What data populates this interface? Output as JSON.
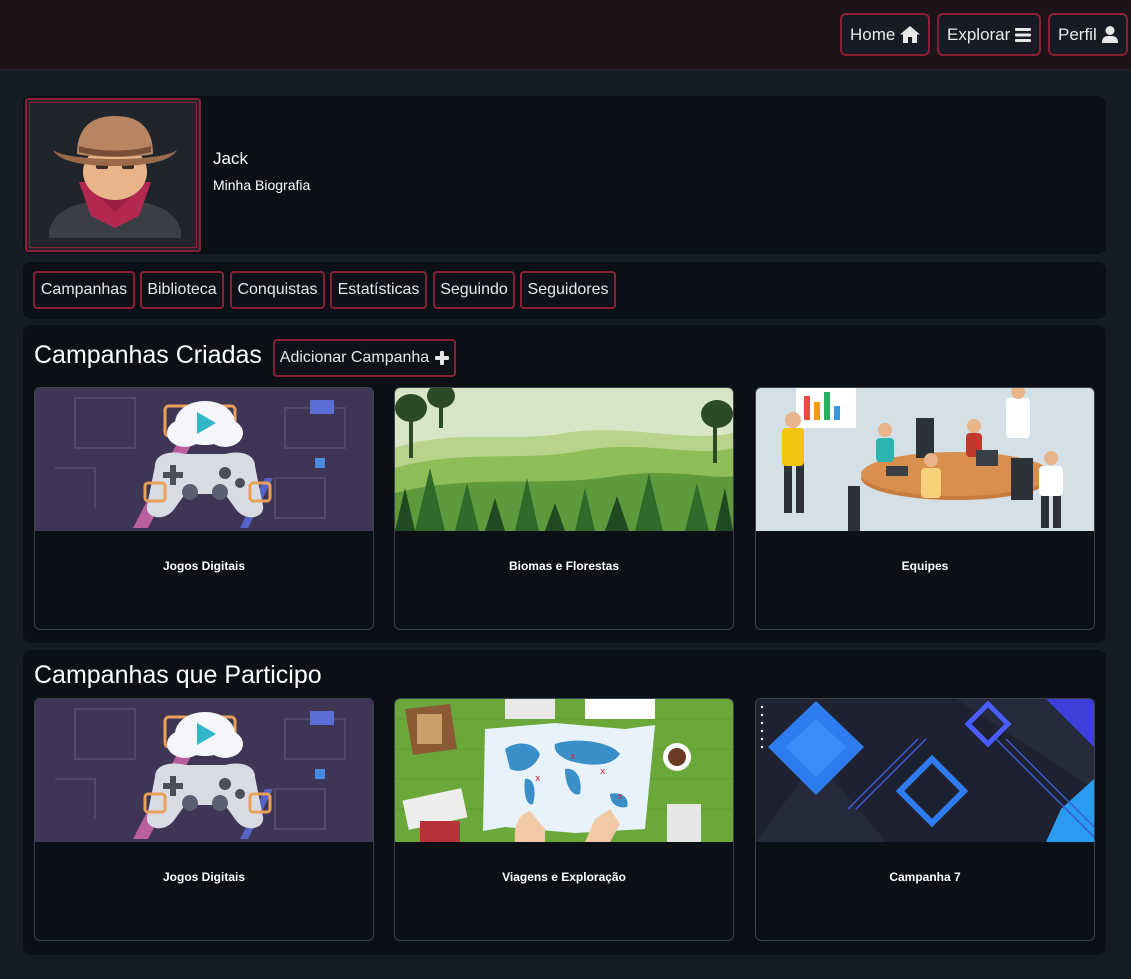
{
  "nav": {
    "home_label": "Home",
    "explore_label": "Explorar",
    "profile_label": "Perfil"
  },
  "profile": {
    "name": "Jack",
    "bio": "Minha Biografia"
  },
  "tabs": [
    "Campanhas",
    "Biblioteca",
    "Conquistas",
    "Estatísticas",
    "Seguindo",
    "Seguidores"
  ],
  "created": {
    "title": "Campanhas Criadas",
    "add_label": "Adicionar Campanha",
    "cards": [
      {
        "title": "Jogos Digitais",
        "image": "game-controller-cloud"
      },
      {
        "title": "Biomas e Florestas",
        "image": "forest-landscape"
      },
      {
        "title": "Equipes",
        "image": "team-meeting"
      }
    ]
  },
  "participating": {
    "title": "Campanhas que Participo",
    "cards": [
      {
        "title": "Jogos Digitais",
        "image": "game-controller-cloud"
      },
      {
        "title": "Viagens e Exploração",
        "image": "travel-map"
      },
      {
        "title": "Campanha 7",
        "image": "blue-geometric"
      }
    ]
  },
  "colors": {
    "accent": "#8a1f35",
    "background": "#141c25",
    "panel": "#0b1017",
    "topbar": "#1c1418"
  }
}
